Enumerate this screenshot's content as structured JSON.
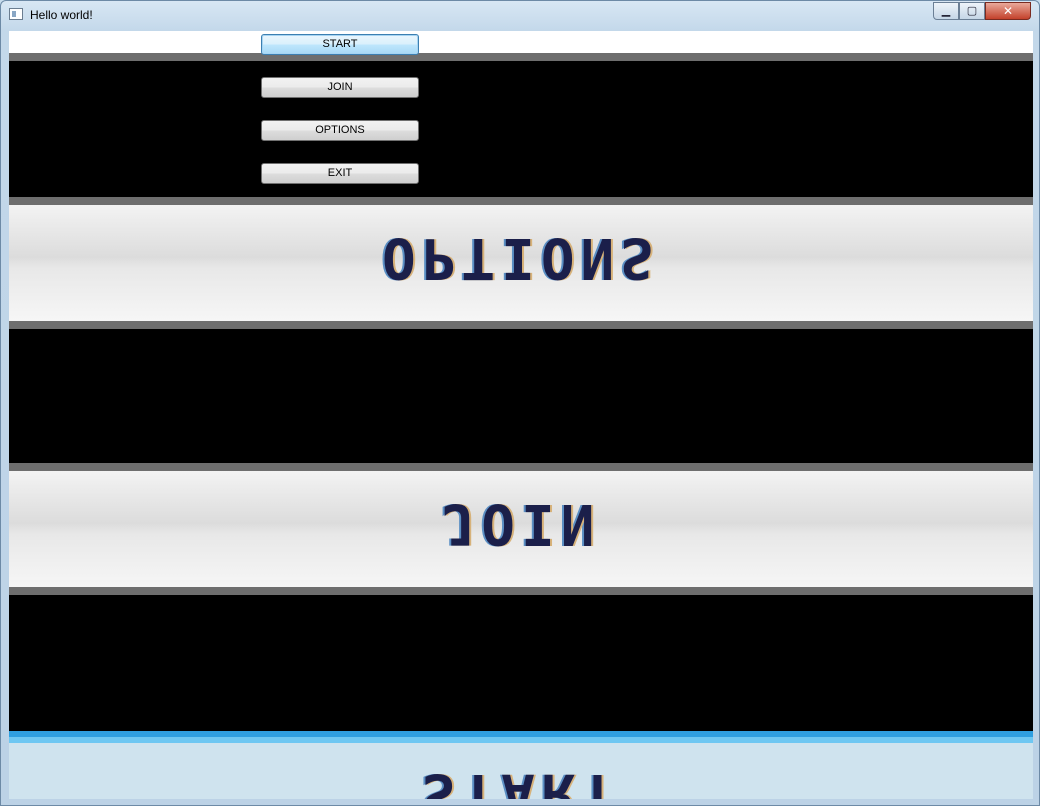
{
  "window": {
    "title": "Hello world!",
    "controls": {
      "minimize": "▁",
      "maximize": "▢",
      "close": "✕"
    }
  },
  "menu": {
    "buttons": [
      {
        "label": "START"
      },
      {
        "label": "JOIN"
      },
      {
        "label": "OPTIONS"
      },
      {
        "label": "EXIT"
      }
    ]
  },
  "canvas": {
    "mirrored_labels": [
      {
        "text": "OPTIONS"
      },
      {
        "text": "JOIN"
      },
      {
        "text": "START"
      }
    ]
  }
}
